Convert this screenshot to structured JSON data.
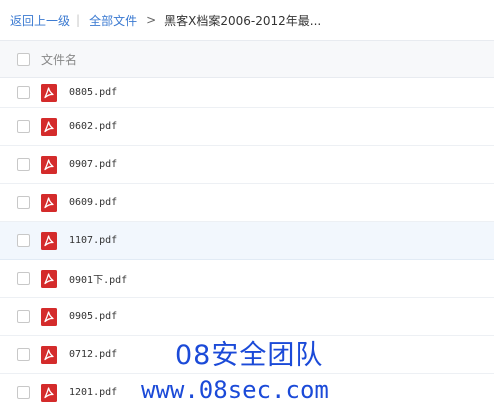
{
  "breadcrumb": {
    "back_label": "返回上一级",
    "all_files_label": "全部文件",
    "arrow": ">",
    "current_label": "黑客X档案2006-2012年最..."
  },
  "table": {
    "column_name": "文件名"
  },
  "files": [
    {
      "name": "0805.pdf"
    },
    {
      "name": "0602.pdf"
    },
    {
      "name": "0907.pdf"
    },
    {
      "name": "0609.pdf"
    },
    {
      "name": "1107.pdf"
    },
    {
      "name": "0901下.pdf"
    },
    {
      "name": "0905.pdf"
    },
    {
      "name": "0712.pdf"
    },
    {
      "name": "1201.pdf"
    }
  ],
  "watermark": {
    "line1": "08安全团队",
    "line2": "www.08sec.com"
  },
  "colors": {
    "link": "#3b7ad1",
    "pdf_red": "#d42b2b",
    "watermark": "#1b4ad8",
    "hover_row": "#f2f7fd"
  }
}
